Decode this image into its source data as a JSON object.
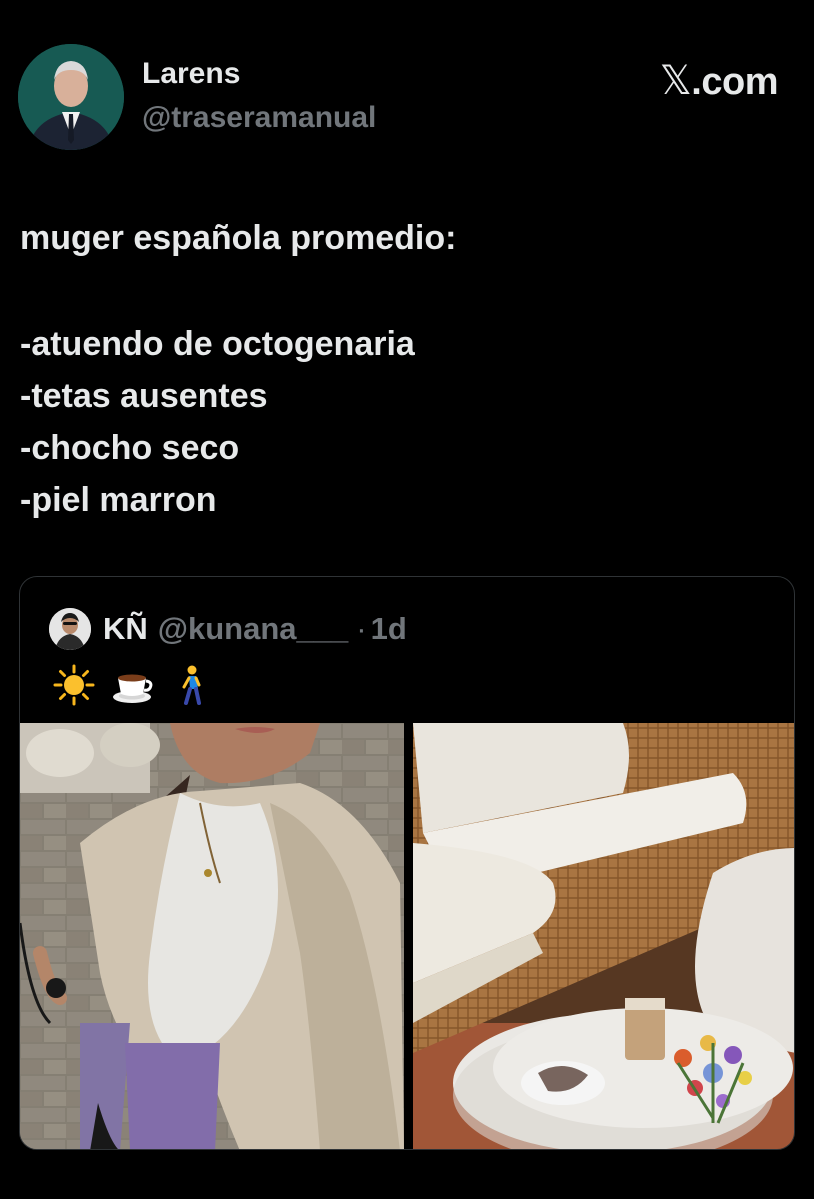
{
  "author": {
    "display_name": "Larens",
    "handle": "@traseramanual",
    "avatar_icon": "profile-photo"
  },
  "brand": {
    "glyph": "𝕏",
    "suffix": ".com"
  },
  "tweet": {
    "lines": [
      "muger española promedio:",
      "",
      "-atuendo de octogenaria",
      "-tetas ausentes",
      "-chocho seco",
      "-piel marron"
    ]
  },
  "quoted": {
    "display_name": "KÑ",
    "handle": "@kunana___",
    "separator": "·",
    "time": "1d",
    "emojis": [
      "sun-emoji",
      "coffee-cup-emoji",
      "walking-person-emoji"
    ],
    "media": [
      {
        "name": "selfie-photo",
        "description_icon": "photo"
      },
      {
        "name": "terrace-photo",
        "description_icon": "photo"
      }
    ]
  },
  "colors": {
    "background": "#000000",
    "text": "#e7e9ea",
    "muted": "#71767b",
    "border": "#2f3336"
  }
}
